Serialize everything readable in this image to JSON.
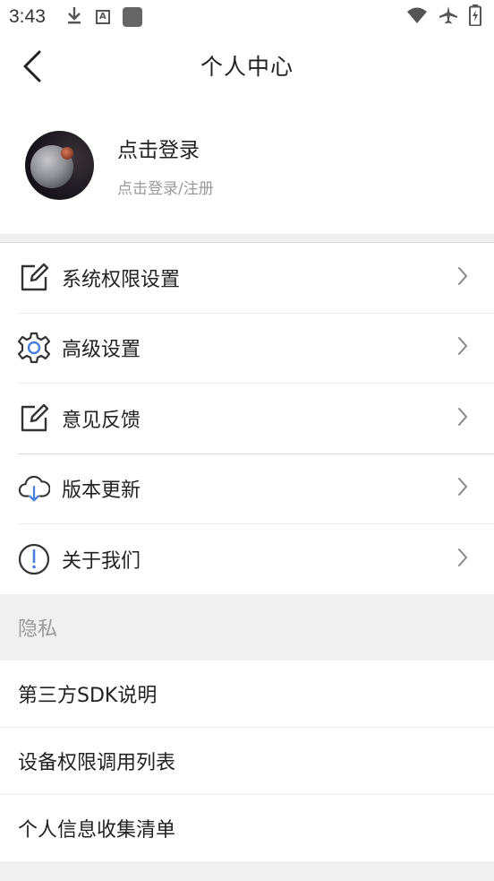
{
  "status_bar": {
    "time": "3:43",
    "icons": [
      "download-icon",
      "a-icon",
      "app-square-icon",
      "wifi-icon",
      "airplane-icon",
      "battery-charging-icon"
    ]
  },
  "header": {
    "title": "个人中心",
    "back_icon": "chevron-left-icon"
  },
  "profile": {
    "login_title": "点击登录",
    "login_subtitle": "点击登录/注册",
    "avatar": "moon-avatar"
  },
  "menu": {
    "items": [
      {
        "label": "系统权限设置",
        "icon": "edit-icon"
      },
      {
        "label": "高级设置",
        "icon": "gear-icon"
      },
      {
        "label": "意见反馈",
        "icon": "edit-icon"
      },
      {
        "label": "版本更新",
        "icon": "cloud-download-icon"
      },
      {
        "label": "关于我们",
        "icon": "info-icon"
      }
    ]
  },
  "privacy": {
    "header": "隐私",
    "items": [
      {
        "label": "第三方SDK说明"
      },
      {
        "label": "设备权限调用列表"
      },
      {
        "label": "个人信息收集清单"
      }
    ]
  },
  "colors": {
    "accent_blue": "#4a7fe0",
    "icon_dark": "#333333",
    "section_bg": "#f0f0f0"
  }
}
